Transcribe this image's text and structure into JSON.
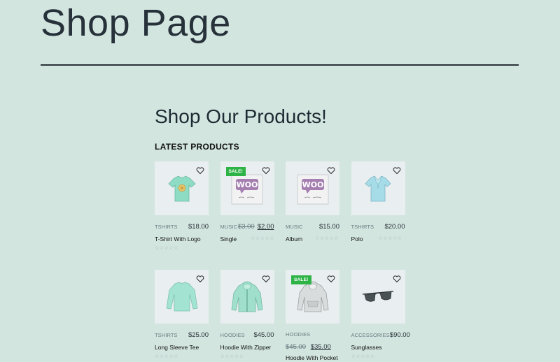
{
  "page": {
    "title": "Shop Page"
  },
  "section": {
    "heading": "Shop Our Products!",
    "latest_label": "LATEST PRODUCTS"
  },
  "colors": {
    "background": "#d2e5df",
    "sale_badge": "#2eb346",
    "thumb_bg": "#e9eef0"
  },
  "products": [
    {
      "category": "TSHIRTS",
      "price": "$18.00",
      "old_price": "",
      "name": "T-Shirt With Logo",
      "sale": false,
      "sale_label": "",
      "rating_stars": "☆☆☆☆☆",
      "image": "tshirt-logo-icon"
    },
    {
      "category": "MUSIC",
      "price": "$2.00",
      "old_price": "$3.00",
      "name": "Single",
      "sale": true,
      "sale_label": "SALE!",
      "rating_stars": "☆☆☆☆☆",
      "image": "woo-single-icon"
    },
    {
      "category": "MUSIC",
      "price": "$15.00",
      "old_price": "",
      "name": "Album",
      "sale": false,
      "sale_label": "",
      "rating_stars": "☆☆☆☆☆",
      "image": "woo-album-icon"
    },
    {
      "category": "TSHIRTS",
      "price": "$20.00",
      "old_price": "",
      "name": "Polo",
      "sale": false,
      "sale_label": "",
      "rating_stars": "☆☆☆☆☆",
      "image": "polo-icon"
    },
    {
      "category": "TSHIRTS",
      "price": "$25.00",
      "old_price": "",
      "name": "Long Sleeve Tee",
      "sale": false,
      "sale_label": "",
      "rating_stars": "☆☆☆☆☆",
      "image": "long-sleeve-icon"
    },
    {
      "category": "HOODIES",
      "price": "$45.00",
      "old_price": "",
      "name": "Hoodie With Zipper",
      "sale": false,
      "sale_label": "",
      "rating_stars": "☆☆☆☆☆",
      "image": "hoodie-zipper-icon"
    },
    {
      "category": "HOODIES",
      "price": "$35.00",
      "old_price": "$45.00",
      "name": "Hoodie With Pocket",
      "sale": true,
      "sale_label": "SALE!",
      "rating_stars": "☆☆☆☆☆",
      "image": "hoodie-pocket-icon"
    },
    {
      "category": "ACCESSORIES",
      "price": "$90.00",
      "old_price": "",
      "name": "Sunglasses",
      "sale": false,
      "sale_label": "",
      "rating_stars": "☆☆☆☆☆",
      "image": "sunglasses-icon"
    }
  ]
}
